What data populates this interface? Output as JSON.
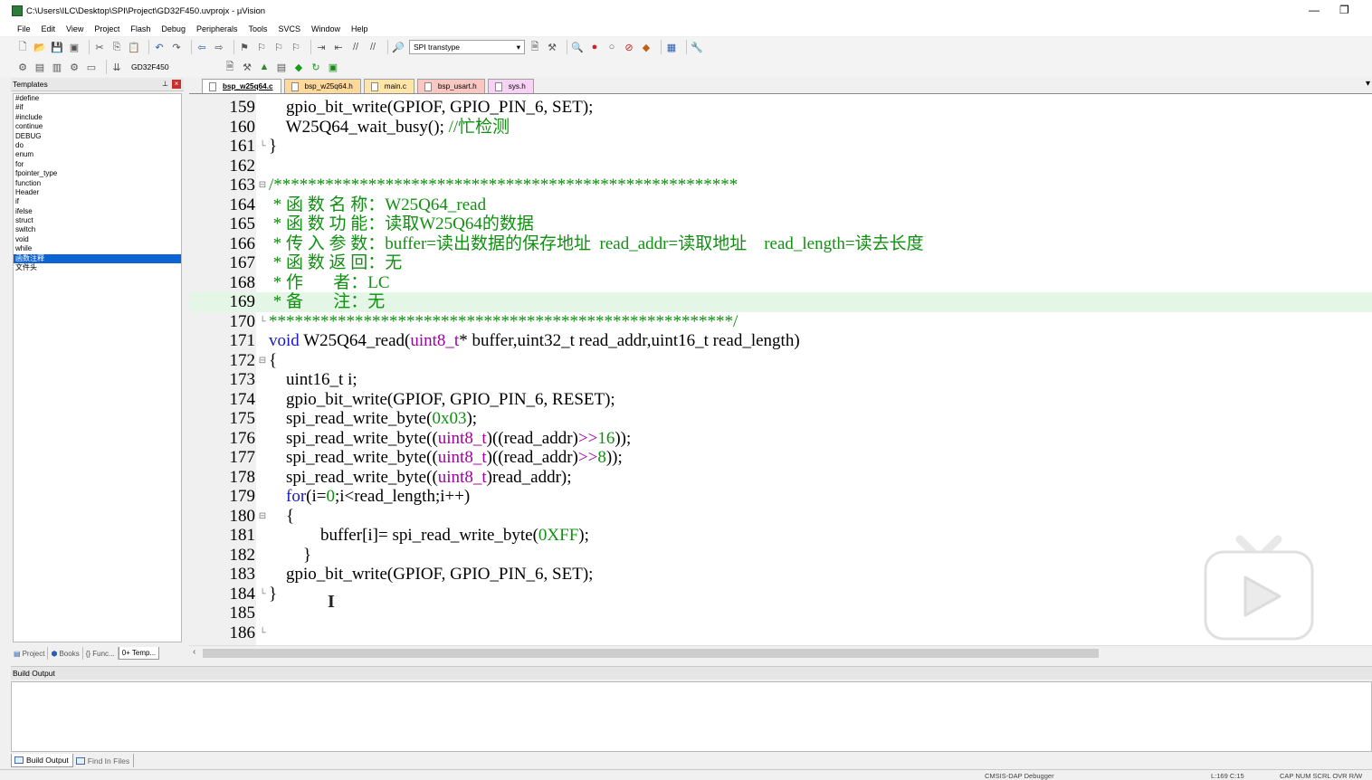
{
  "window": {
    "title": "C:\\Users\\ILC\\Desktop\\SPI\\Project\\GD32F450.uvprojx - µVision",
    "minimize": "—",
    "restore": "❐"
  },
  "menu": [
    "File",
    "Edit",
    "View",
    "Project",
    "Flash",
    "Debug",
    "Peripherals",
    "Tools",
    "SVCS",
    "Window",
    "Help"
  ],
  "toolbar": {
    "find_combo": "SPI transtype",
    "target_combo": "GD32F450"
  },
  "templates_panel": {
    "title": "Templates",
    "items": [
      "#define",
      "#if",
      "#include",
      "continue",
      "DEBUG",
      "do",
      "enum",
      "for",
      "fpointer_type",
      "function",
      "Header",
      "if",
      "ifelse",
      "struct",
      "switch",
      "void",
      "while",
      "函数注释",
      "文件头"
    ],
    "selected_index": 17,
    "tabs": [
      "Project",
      "Books",
      "{} Func...",
      "0+ Temp..."
    ]
  },
  "editor_tabs": [
    "bsp_w25q64.c",
    "bsp_w25q64.h",
    "main.c",
    "bsp_usart.h",
    "sys.h"
  ],
  "active_tab_index": 0,
  "code_lines": [
    {
      "n": "159",
      "fold": "",
      "html": "    gpio_bit_write(GPIOF, GPIO_PIN_6, SET);"
    },
    {
      "n": "160",
      "fold": "",
      "html": "    W25Q64_wait_busy(); <span class='g'>//忙检测</span>"
    },
    {
      "n": "161",
      "fold": "└",
      "html": "}"
    },
    {
      "n": "162",
      "fold": "",
      "html": ""
    },
    {
      "n": "163",
      "fold": "⊟",
      "html": "<span class='g'>/******************************************************</span>"
    },
    {
      "n": "164",
      "fold": "",
      "html": "<span class='g'> * 函 数 名 称：W25Q64_read</span>"
    },
    {
      "n": "165",
      "fold": "",
      "html": "<span class='g'> * 函 数 功 能：读取W25Q64的数据</span>"
    },
    {
      "n": "166",
      "fold": "",
      "html": "<span class='g'> * 传 入 参 数：buffer=读出数据的保存地址  read_addr=读取地址    read_length=读去长度</span>"
    },
    {
      "n": "167",
      "fold": "",
      "html": "<span class='g'> * 函 数 返 回：无</span>"
    },
    {
      "n": "168",
      "fold": "",
      "html": "<span class='g'> * 作       者：LC</span>"
    },
    {
      "n": "169",
      "fold": "",
      "html": "<span class='g'> * 备       注：无</span>",
      "hl": true
    },
    {
      "n": "170",
      "fold": "└",
      "html": "<span class='g'>******************************************************/</span>"
    },
    {
      "n": "171",
      "fold": "",
      "html": "<span class='b'>void</span> W25Q64_read(<span class='p'>uint8_t</span>* buffer,uint32_t read_addr,uint16_t read_length)"
    },
    {
      "n": "172",
      "fold": "⊟",
      "html": "{"
    },
    {
      "n": "173",
      "fold": "",
      "html": "    uint16_t i;"
    },
    {
      "n": "174",
      "fold": "",
      "html": "    gpio_bit_write(GPIOF, GPIO_PIN_6, RESET);"
    },
    {
      "n": "175",
      "fold": "",
      "html": "    spi_read_write_byte(<span class='g'>0x03</span>);"
    },
    {
      "n": "176",
      "fold": "",
      "html": "    spi_read_write_byte((<span class='p'>uint8_t</span>)((read_addr)<span class='p'>&gt;&gt;</span><span class='g'>16</span>));"
    },
    {
      "n": "177",
      "fold": "",
      "html": "    spi_read_write_byte((<span class='p'>uint8_t</span>)((read_addr)<span class='p'>&gt;&gt;</span><span class='g'>8</span>));"
    },
    {
      "n": "178",
      "fold": "",
      "html": "    spi_read_write_byte((<span class='p'>uint8_t</span>)read_addr);"
    },
    {
      "n": "179",
      "fold": "",
      "html": "    <span class='b'>for</span>(i=<span class='g'>0</span>;i&lt;read_length;i++)"
    },
    {
      "n": "180",
      "fold": "⊟",
      "html": "    {"
    },
    {
      "n": "181",
      "fold": "",
      "html": "            buffer[i]= spi_read_write_byte(<span class='g'>0XFF</span>);"
    },
    {
      "n": "182",
      "fold": "",
      "html": "        }"
    },
    {
      "n": "183",
      "fold": "",
      "html": "    gpio_bit_write(GPIOF, GPIO_PIN_6, SET);"
    },
    {
      "n": "184",
      "fold": "└",
      "html": "}"
    },
    {
      "n": "185",
      "fold": "",
      "html": ""
    },
    {
      "n": "186",
      "fold": "└",
      "html": ""
    }
  ],
  "build_output": {
    "title": "Build Output",
    "tabs": [
      "Build Output",
      "Find In Files"
    ]
  },
  "statusbar": {
    "debugger": "CMSIS-DAP Debugger",
    "position": "L:169 C:15",
    "indicators": "CAP  NUM  SCRL  OVR  R/W"
  }
}
